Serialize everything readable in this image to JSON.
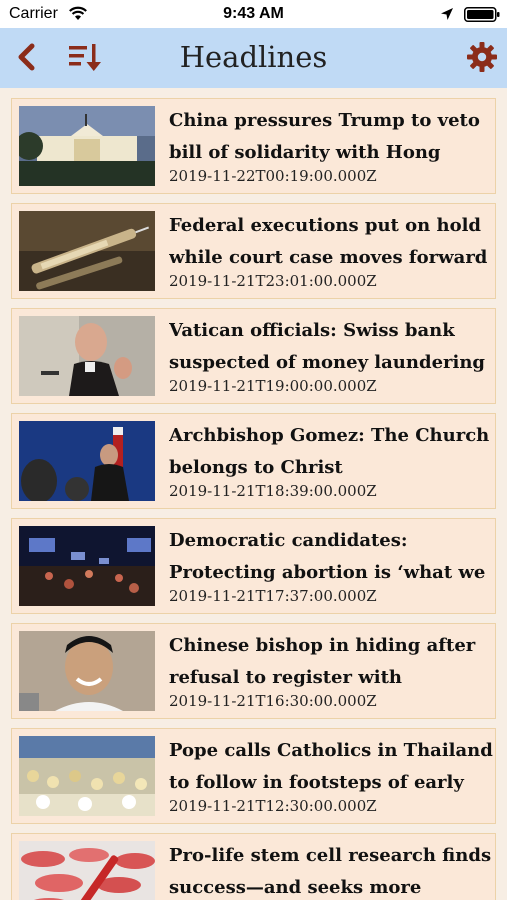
{
  "status_bar": {
    "carrier": "Carrier",
    "time": "9:43 AM"
  },
  "nav": {
    "title": "Headlines",
    "back_icon": "chevron-left-icon",
    "sort_icon": "sort-icon",
    "settings_icon": "gear-icon",
    "accent_color": "#8b2c1a"
  },
  "headlines": [
    {
      "title": "China pressures Trump to veto bill of solidarity with Hong Kong",
      "date": "2019-11-22T00:19:00.000Z"
    },
    {
      "title": "Federal executions put on hold while court case moves forward",
      "date": "2019-11-21T23:01:00.000Z"
    },
    {
      "title": "Vatican officials: Swiss bank suspected of money laundering",
      "date": "2019-11-21T19:00:00.000Z"
    },
    {
      "title": "Archbishop Gomez: The Church belongs to Christ",
      "date": "2019-11-21T18:39:00.000Z"
    },
    {
      "title": "Democratic candidates: Protecting abortion is ‘what we",
      "date": "2019-11-21T17:37:00.000Z"
    },
    {
      "title": "Chinese bishop in hiding after refusal to register with",
      "date": "2019-11-21T16:30:00.000Z"
    },
    {
      "title": "Pope calls Catholics in Thailand to follow in footsteps of early",
      "date": "2019-11-21T12:30:00.000Z"
    },
    {
      "title": "Pro-life stem cell research finds success—and seeks more",
      "date": ""
    }
  ]
}
